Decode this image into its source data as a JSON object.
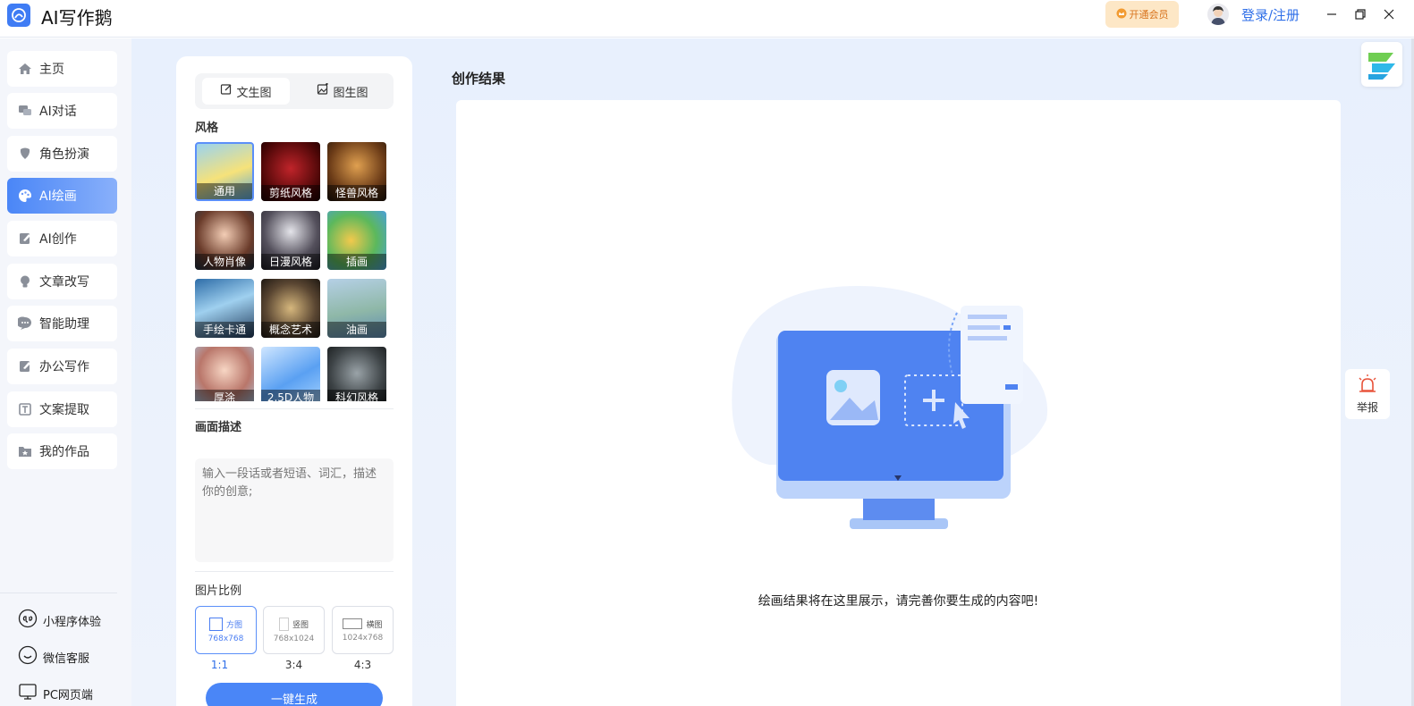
{
  "app": {
    "title": "AI写作鹅",
    "vip_label": "开通会员",
    "login_label": "登录/注册"
  },
  "sidebar": {
    "items": [
      {
        "label": "主页",
        "icon": "home-icon"
      },
      {
        "label": "AI对话",
        "icon": "chat-icon"
      },
      {
        "label": "角色扮演",
        "icon": "roleplay-icon"
      },
      {
        "label": "AI绘画",
        "icon": "palette-icon",
        "active": true
      },
      {
        "label": "AI创作",
        "icon": "edit-doc-icon"
      },
      {
        "label": "文章改写",
        "icon": "bulb-icon"
      },
      {
        "label": "智能助理",
        "icon": "assistant-icon"
      },
      {
        "label": "办公写作",
        "icon": "office-icon"
      },
      {
        "label": "文案提取",
        "icon": "extract-icon"
      },
      {
        "label": "我的作品",
        "icon": "folder-icon"
      }
    ],
    "bottom": [
      {
        "label": "小程序体验",
        "icon": "miniprogram-icon"
      },
      {
        "label": "微信客服",
        "icon": "wechat-service-icon"
      },
      {
        "label": "PC网页端",
        "icon": "pc-web-icon"
      }
    ]
  },
  "panel": {
    "tabs": [
      {
        "label": "文生图",
        "icon": "edit-icon"
      },
      {
        "label": "图生图",
        "icon": "image-edit-icon"
      }
    ],
    "style_title": "风格",
    "styles": [
      "通用",
      "剪纸风格",
      "怪兽风格",
      "人物肖像",
      "日漫风格",
      "插画",
      "手绘卡通",
      "概念艺术",
      "油画",
      "厚涂",
      "2.5D人物",
      "科幻风格"
    ],
    "desc_title": "画面描述",
    "desc_placeholder": "输入一段话或者短语、词汇，描述你的创意;",
    "ratio_title": "图片比例",
    "ratios": [
      {
        "name": "方图",
        "size": "768x768",
        "label": "1:1"
      },
      {
        "name": "竖图",
        "size": "768x1024",
        "label": "3:4"
      },
      {
        "name": "横图",
        "size": "1024x768",
        "label": "4:3"
      }
    ],
    "generate_label": "一键生成"
  },
  "result": {
    "title": "创作结果",
    "empty_message": "绘画结果将在这里展示，请完善你要生成的内容吧!"
  },
  "report_label": "举报",
  "colors": {
    "accent": "#4a86f7",
    "vip_bg": "#fde7c6",
    "vip_text": "#d8731c"
  }
}
